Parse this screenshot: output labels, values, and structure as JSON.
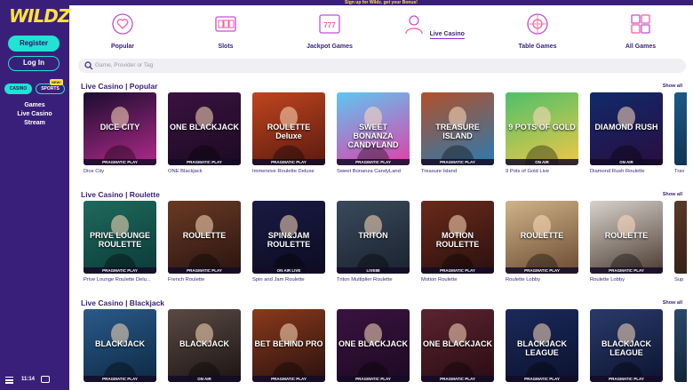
{
  "top_banner": "Sign up for Wildz. get your Bonus!",
  "sidebar": {
    "logo": "WILDZ",
    "register": "Register",
    "login": "Log In",
    "toggle_casino": "CASINO",
    "toggle_sports": "SPORTS",
    "new_badge": "NEW!",
    "links": [
      "Games",
      "Live Casino",
      "Stream"
    ],
    "time": "11:14"
  },
  "categories": [
    {
      "label": "Popular",
      "icon": "heart-cursor-icon"
    },
    {
      "label": "Slots",
      "icon": "slot-machine-icon"
    },
    {
      "label": "Jackpot Games",
      "icon": "jackpot-777-icon"
    },
    {
      "label": "Live Casino",
      "icon": "live-dealer-icon"
    },
    {
      "label": "Table Games",
      "icon": "roulette-wheel-icon"
    },
    {
      "label": "All Games",
      "icon": "grid-icon"
    }
  ],
  "search": {
    "placeholder": "Game, Provider or Tag"
  },
  "show_all": "Show all",
  "sections": [
    {
      "title": "Live Casino | Popular",
      "games": [
        {
          "name": "Dice City",
          "provider": "PRAGMATIC PLAY",
          "art": "DICE CITY",
          "colors": [
            "#1b0d2e",
            "#b02a8b"
          ]
        },
        {
          "name": "ONE Blackjack",
          "provider": "PRAGMATIC PLAY",
          "art": "ONE BLACKJACK",
          "colors": [
            "#3a1240",
            "#1c0a22"
          ]
        },
        {
          "name": "Immersive Roulette Deluxe",
          "provider": "PRAGMATIC PLAY",
          "art": "ROULETTE Deluxe",
          "colors": [
            "#c0451e",
            "#5a1a10"
          ]
        },
        {
          "name": "Sweet Bonanza CandyLand",
          "provider": "PRAGMATIC PLAY",
          "art": "SWEET BONANZA CANDYLAND",
          "colors": [
            "#5ec6f2",
            "#e13fa7"
          ]
        },
        {
          "name": "Treasure Island",
          "provider": "PRAGMATIC PLAY",
          "art": "TREASURE ISLAND",
          "colors": [
            "#b2502a",
            "#2a7bb0"
          ]
        },
        {
          "name": "9 Pots of Gold Live",
          "provider": "ON AIR",
          "art": "9 POTS OF GOLD",
          "colors": [
            "#4ec06a",
            "#f0c845"
          ]
        },
        {
          "name": "Diamond Rush Roulette",
          "provider": "ON AIR",
          "art": "DIAMOND RUSH",
          "colors": [
            "#102a6a",
            "#2a0d40"
          ]
        },
        {
          "name": "Trav",
          "provider": "",
          "art": "",
          "colors": [
            "#1b5a8a",
            "#0d2a44"
          ]
        }
      ]
    },
    {
      "title": "Live Casino | Roulette",
      "games": [
        {
          "name": "Prive Lounge Roulette Delu...",
          "provider": "PRAGMATIC PLAY",
          "art": "PRIVE LOUNGE ROULETTE",
          "colors": [
            "#1e6a5c",
            "#0c3a3a"
          ]
        },
        {
          "name": "French Roulette",
          "provider": "PRAGMATIC PLAY",
          "art": "ROULETTE",
          "colors": [
            "#6a3a24",
            "#2a1410"
          ]
        },
        {
          "name": "Spin and Jam Roulette",
          "provider": "ON AIR LIVE",
          "art": "SPIN&JAM ROULETTE",
          "colors": [
            "#1a1a44",
            "#0c0c22"
          ]
        },
        {
          "name": "Triton Multiplier Roulette",
          "provider": "LIVE88",
          "art": "TRITON",
          "colors": [
            "#3a4a5a",
            "#1a2230"
          ]
        },
        {
          "name": "Motion Roulette",
          "provider": "PRAGMATIC PLAY",
          "art": "MOTION ROULETTE",
          "colors": [
            "#6a2a1a",
            "#2a1010"
          ]
        },
        {
          "name": "Roulette Lobby",
          "provider": "PRAGMATIC PLAY",
          "art": "ROULETTE",
          "colors": [
            "#d0b48a",
            "#6a4a30"
          ]
        },
        {
          "name": "Roulette Lobby",
          "provider": "PRAGMATIC PLAY",
          "art": "ROULETTE",
          "colors": [
            "#d8d2cc",
            "#4a3a30"
          ]
        },
        {
          "name": "Sup",
          "provider": "",
          "art": "",
          "colors": [
            "#5a3a2a",
            "#2a1a10"
          ]
        }
      ]
    },
    {
      "title": "Live Casino | Blackjack",
      "games": [
        {
          "name": "",
          "provider": "PRAGMATIC PLAY",
          "art": "BLACKJACK",
          "colors": [
            "#2a5a8a",
            "#0c2a44"
          ]
        },
        {
          "name": "",
          "provider": "ON AIR",
          "art": "BLACKJACK",
          "colors": [
            "#5a4a44",
            "#1c1412"
          ]
        },
        {
          "name": "",
          "provider": "PRAGMATIC PLAY",
          "art": "BET BEHIND PRO",
          "colors": [
            "#8a3a1a",
            "#2a1010"
          ]
        },
        {
          "name": "",
          "provider": "PRAGMATIC PLAY",
          "art": "ONE BLACKJACK",
          "colors": [
            "#3a1240",
            "#1c0a22"
          ]
        },
        {
          "name": "",
          "provider": "PRAGMATIC PLAY",
          "art": "ONE BLACKJACK",
          "colors": [
            "#5a2430",
            "#2a0c14"
          ]
        },
        {
          "name": "",
          "provider": "PRAGMATIC PLAY",
          "art": "BLACKJACK LEAGUE",
          "colors": [
            "#1a2a5a",
            "#0c1230"
          ]
        },
        {
          "name": "",
          "provider": "PRAGMATIC PLAY",
          "art": "BLACKJACK LEAGUE",
          "colors": [
            "#2a3a6a",
            "#0c1430"
          ]
        },
        {
          "name": "",
          "provider": "",
          "art": "",
          "colors": [
            "#2a4a6a",
            "#0c1a2a"
          ]
        }
      ]
    }
  ]
}
